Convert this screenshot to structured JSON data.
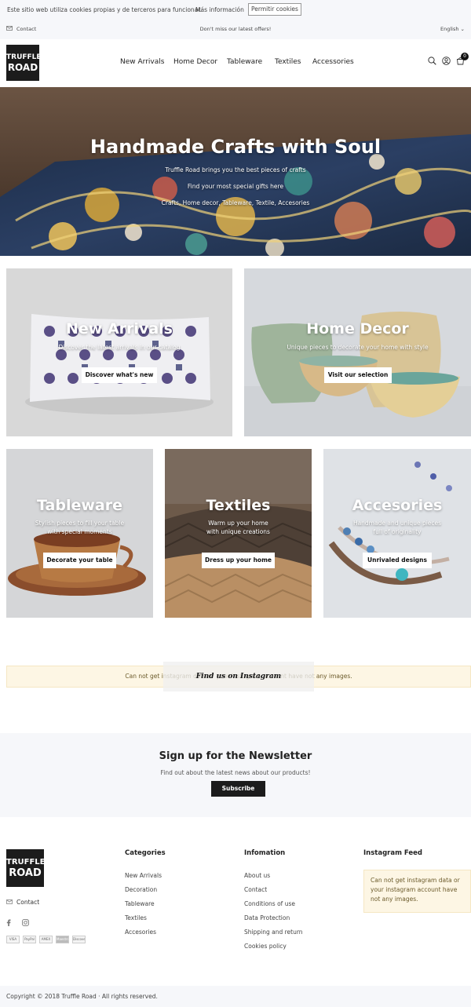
{
  "cookie": {
    "text": "Este sitio web utiliza cookies propias y de terceros para funcionar.",
    "more_info": "Más información",
    "allow_button": "Permitir cookies"
  },
  "topbar": {
    "contact": "Contact",
    "promo": "Don't miss our latest offers!",
    "language": "English ⌄"
  },
  "header": {
    "logo_line1": "TRUFFLE",
    "logo_line2": "ROAD",
    "nav": [
      "New Arrivals",
      "Home Decor",
      "Tableware",
      "Textiles",
      "Accessories"
    ],
    "cart_count": "0",
    "icons": [
      "search-icon",
      "user-icon",
      "cart-icon"
    ]
  },
  "hero": {
    "title": "Handmade Crafts with Soul",
    "lines": [
      "Truffle Road brings you the best pieces of crafts",
      "Find your most special gifts here",
      "Crafts, Home decor, Tableware, Textile, Accesories"
    ]
  },
  "tiles": [
    {
      "title": "New Arrivals",
      "subtitle": [
        "Discover the latest arrivals in our catalog"
      ],
      "button": "Discover what's new"
    },
    {
      "title": "Home Decor",
      "subtitle": [
        "Unique pieces to decorate your home with style"
      ],
      "button": "Visit our selection"
    },
    {
      "title": "Tableware",
      "subtitle": [
        "Stylish pieces to fill your table",
        "with special moments"
      ],
      "button": "Decorate your table"
    },
    {
      "title": "Textiles",
      "subtitle": [
        "Warm up your home",
        "with unique creations"
      ],
      "button": "Dress up your home"
    },
    {
      "title": "Accesories",
      "subtitle": [
        "Handmade and unique pieces",
        "full of originality"
      ],
      "button": "Unrivaled designs"
    }
  ],
  "instagram": {
    "warning": "Can not get instagram data or your instagram account have not any images.",
    "label": "Find us on Instagram"
  },
  "newsletter": {
    "title": "Sign up for the Newsletter",
    "subtitle": "Find out about the latest news about our products!",
    "button": "Subscribe"
  },
  "footer": {
    "logo_line1": "TRUFFLE",
    "logo_line2": "ROAD",
    "contact": "Contact",
    "payments": [
      "VISA",
      "PayPal",
      "AMEX",
      "Maestro",
      "Discover"
    ],
    "categories": {
      "title": "Categories",
      "items": [
        "New Arrivals",
        "Decoration",
        "Tableware",
        "Textiles",
        "Accesories"
      ]
    },
    "information": {
      "title": "Infomation",
      "items": [
        "About us",
        "Contact",
        "Conditions of use",
        "Data Protection",
        "Shipping and return",
        "Cookies policy"
      ]
    },
    "instagram_feed": {
      "title": "Instagram Feed",
      "warning": "Can not get instagram data or your instagram account have not any images."
    }
  },
  "copyright": "Copyright © 2018 Truffle Road · All rights reserved."
}
